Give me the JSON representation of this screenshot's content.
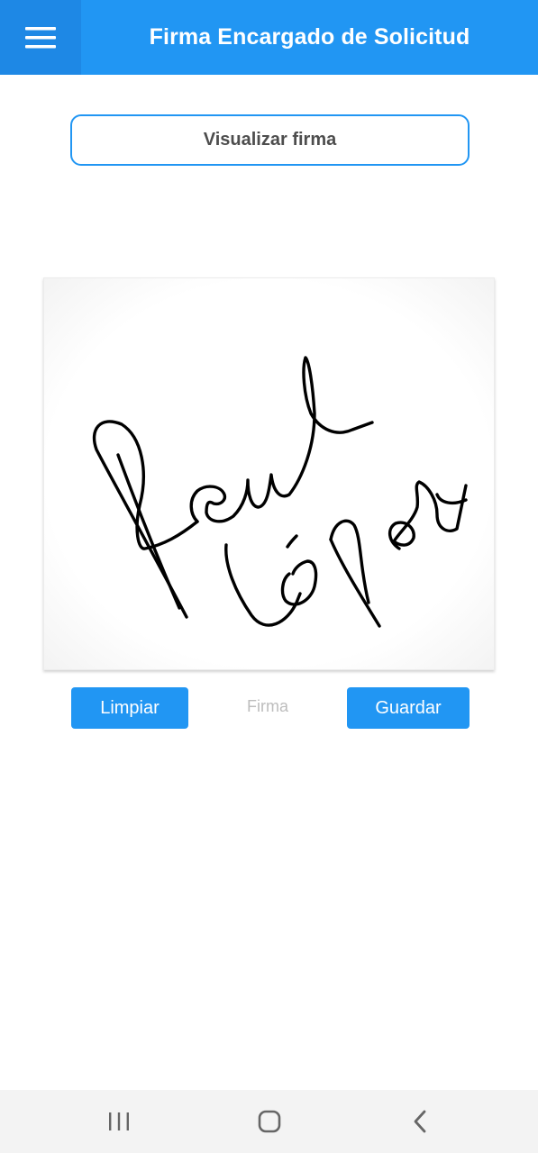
{
  "appbar": {
    "title": "Firma Encargado de Solicitud",
    "menu_icon": "hamburger-menu-icon",
    "color": "#2196f3"
  },
  "actions": {
    "view_signature": "Visualizar firma",
    "clear": "Limpiar",
    "save": "Guardar",
    "caption": "Firma"
  },
  "signature": {
    "content": "handwritten signature drawing"
  },
  "navbar": {
    "recent_icon": "recent-apps-icon",
    "home_icon": "home-icon",
    "back_icon": "back-icon"
  }
}
